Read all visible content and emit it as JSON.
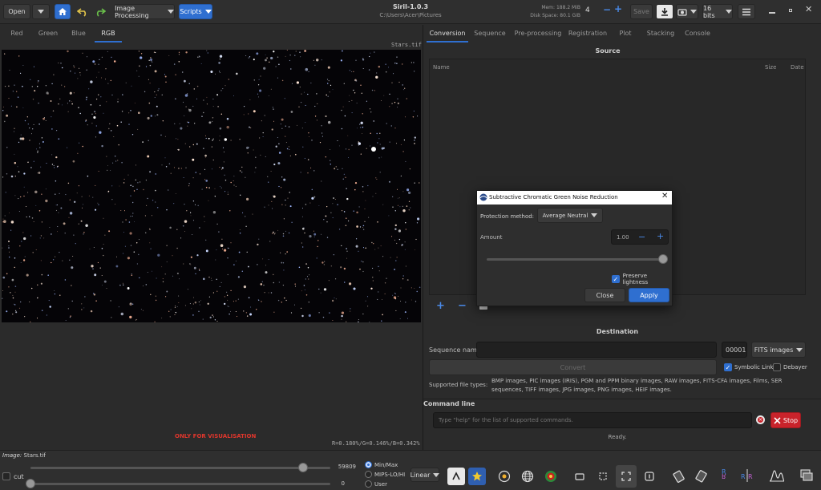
{
  "header": {
    "open_label": "Open",
    "image_processing_label": "Image Processing",
    "scripts_label": "Scripts",
    "app_title": "Siril-1.0.3",
    "working_dir": "C:\\Users\\Acer\\Pictures",
    "mem": "Mem: 188.2 MiB",
    "disk": "Disk Space: 80.1 GiB",
    "threads": "4",
    "save_label": "Save",
    "bits_label": "16 bits"
  },
  "left": {
    "channel_tabs": [
      "Red",
      "Green",
      "Blue",
      "RGB"
    ],
    "image_name": "Stars.tif",
    "visualisation_note": "ONLY FOR VISUALISATION",
    "pixel_readout": "R=0.180%/G=0.146%/B=0.342%"
  },
  "bottom": {
    "image_label": "Image:",
    "image_value": "Stars.tif",
    "cut_label": "cut",
    "high_value": "59809",
    "low_value": "0",
    "high_fraction": 0.91,
    "low_fraction": 0.0,
    "radio_options": [
      "Min/Max",
      "MIPS-LO/HI",
      "User"
    ],
    "selected_radio": 0,
    "scale_label": "Linear"
  },
  "right": {
    "tabs": [
      "Conversion",
      "Sequence",
      "Pre-processing",
      "Registration",
      "Plot",
      "Stacking",
      "Console"
    ],
    "source_title": "Source",
    "source_columns": [
      "Name",
      "Size",
      "Date"
    ],
    "destination_title": "Destination",
    "sequence_name_label": "Sequence name:",
    "sequence_number": "00001",
    "format_label": "FITS images",
    "convert_label": "Convert",
    "symbolic_link_label": "Symbolic Link",
    "debayer_label": "Debayer",
    "supported_label": "Supported file types:",
    "supported_types": "BMP images, PIC images (IRIS), PGM and PPM binary images, RAW images, FITS-CFA images, Films, SER sequences, TIFF images, JPG images, PNG images, HEIF images.",
    "command_line_title": "Command line",
    "command_placeholder": "Type \"help\" for the list of supported commands.",
    "stop_label": "Stop",
    "status": "Ready."
  },
  "dialog": {
    "title": "Subtractive Chromatic Green Noise Reduction",
    "protection_label": "Protection method:",
    "protection_value": "Average Neutral",
    "amount_label": "Amount",
    "amount_value": "1.00",
    "amount_fraction": 1.0,
    "preserve_label": "Preserve lightness",
    "close_label": "Close",
    "apply_label": "Apply"
  },
  "colors": {
    "accent": "#2f6fd0",
    "stop": "#c9232b",
    "note": "#e0362c"
  }
}
